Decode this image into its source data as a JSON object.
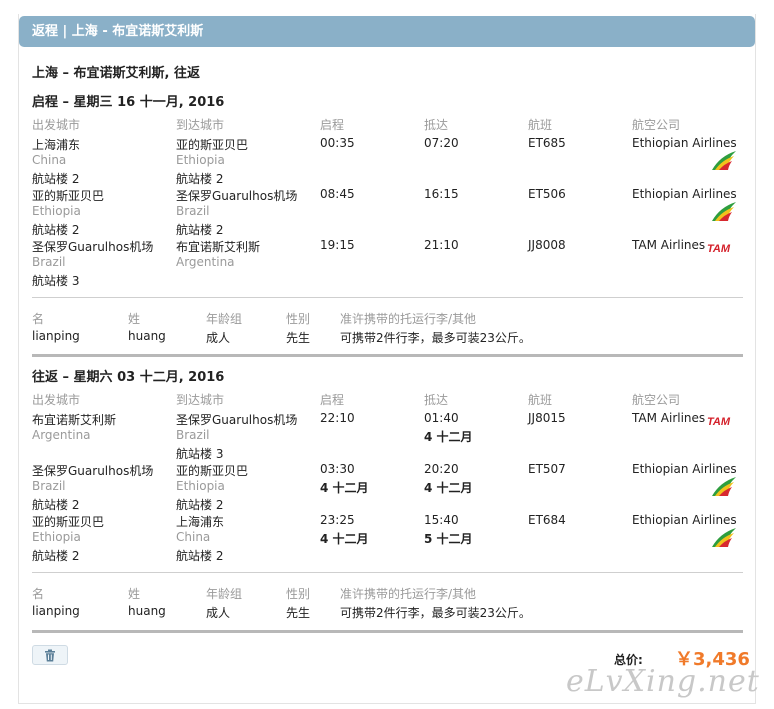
{
  "header": {
    "title": "返程 | 上海 - 布宜诺斯艾利斯"
  },
  "route_title": "上海 – 布宜诺斯艾利斯, 往返",
  "columns": {
    "from": "出发城市",
    "to": "到达城市",
    "depart": "启程",
    "arrive": "抵达",
    "flight": "航班",
    "airline": "航空公司"
  },
  "pax_columns": {
    "first": "名",
    "last": "姓",
    "age": "年龄组",
    "gender": "性别",
    "baggage": "准许携带的托运行李/其他"
  },
  "outbound": {
    "title": "启程 – 星期三 16 十一月, 2016",
    "flights": [
      {
        "from_city": "上海浦东",
        "from_country": "China",
        "from_terminal": "航站楼 2",
        "to_city": "亚的斯亚贝巴",
        "to_country": "Ethiopia",
        "to_terminal": "航站楼 2",
        "depart": "00:35",
        "depart_date": "",
        "arrive": "07:20",
        "arrive_date": "",
        "flight": "ET685",
        "airline": "Ethiopian Airlines",
        "logo": "ethiopian-logo"
      },
      {
        "from_city": "亚的斯亚贝巴",
        "from_country": "Ethiopia",
        "from_terminal": "航站楼 2",
        "to_city": "圣保罗Guarulhos机场",
        "to_country": "Brazil",
        "to_terminal": "航站楼 2",
        "depart": "08:45",
        "depart_date": "",
        "arrive": "16:15",
        "arrive_date": "",
        "flight": "ET506",
        "airline": "Ethiopian Airlines",
        "logo": "ethiopian-logo"
      },
      {
        "from_city": "圣保罗Guarulhos机场",
        "from_country": "Brazil",
        "from_terminal": "航站楼 3",
        "to_city": "布宜诺斯艾利斯",
        "to_country": "Argentina",
        "to_terminal": "",
        "depart": "19:15",
        "depart_date": "",
        "arrive": "21:10",
        "arrive_date": "",
        "flight": "JJ8008",
        "airline": "TAM Airlines",
        "logo": "tam-logo"
      }
    ],
    "passenger": {
      "first": "lianping",
      "last": "huang",
      "age": "成人",
      "gender": "先生",
      "baggage": "可携带2件行李，最多可装23公斤。"
    }
  },
  "return": {
    "title": "往返 – 星期六 03 十二月, 2016",
    "flights": [
      {
        "from_city": "布宜诺斯艾利斯",
        "from_country": "Argentina",
        "from_terminal": "",
        "to_city": "圣保罗Guarulhos机场",
        "to_country": "Brazil",
        "to_terminal": "航站楼 3",
        "depart": "22:10",
        "depart_date": "",
        "arrive": "01:40",
        "arrive_date": "4 十二月",
        "flight": "JJ8015",
        "airline": "TAM Airlines",
        "logo": "tam-logo"
      },
      {
        "from_city": "圣保罗Guarulhos机场",
        "from_country": "Brazil",
        "from_terminal": "航站楼 2",
        "to_city": "亚的斯亚贝巴",
        "to_country": "Ethiopia",
        "to_terminal": "航站楼 2",
        "depart": "03:30",
        "depart_date": "4 十二月",
        "arrive": "20:20",
        "arrive_date": "4 十二月",
        "flight": "ET507",
        "airline": "Ethiopian Airlines",
        "logo": "ethiopian-logo"
      },
      {
        "from_city": "亚的斯亚贝巴",
        "from_country": "Ethiopia",
        "from_terminal": "航站楼 2",
        "to_city": "上海浦东",
        "to_country": "China",
        "to_terminal": "航站楼 2",
        "depart": "23:25",
        "depart_date": "4 十二月",
        "arrive": "15:40",
        "arrive_date": "5 十二月",
        "flight": "ET684",
        "airline": "Ethiopian Airlines",
        "logo": "ethiopian-logo"
      }
    ],
    "passenger": {
      "first": "lianping",
      "last": "huang",
      "age": "成人",
      "gender": "先生",
      "baggage": "可携带2件行李，最多可装23公斤。"
    }
  },
  "total": {
    "label": "总价:",
    "price": "￥3,436"
  },
  "watermark": "eLvXing.net",
  "colors": {
    "header": "#8ab0c8",
    "price": "#f07a2a",
    "muted": "#9a9a9a"
  },
  "icons": {
    "delete": "trash-icon"
  }
}
